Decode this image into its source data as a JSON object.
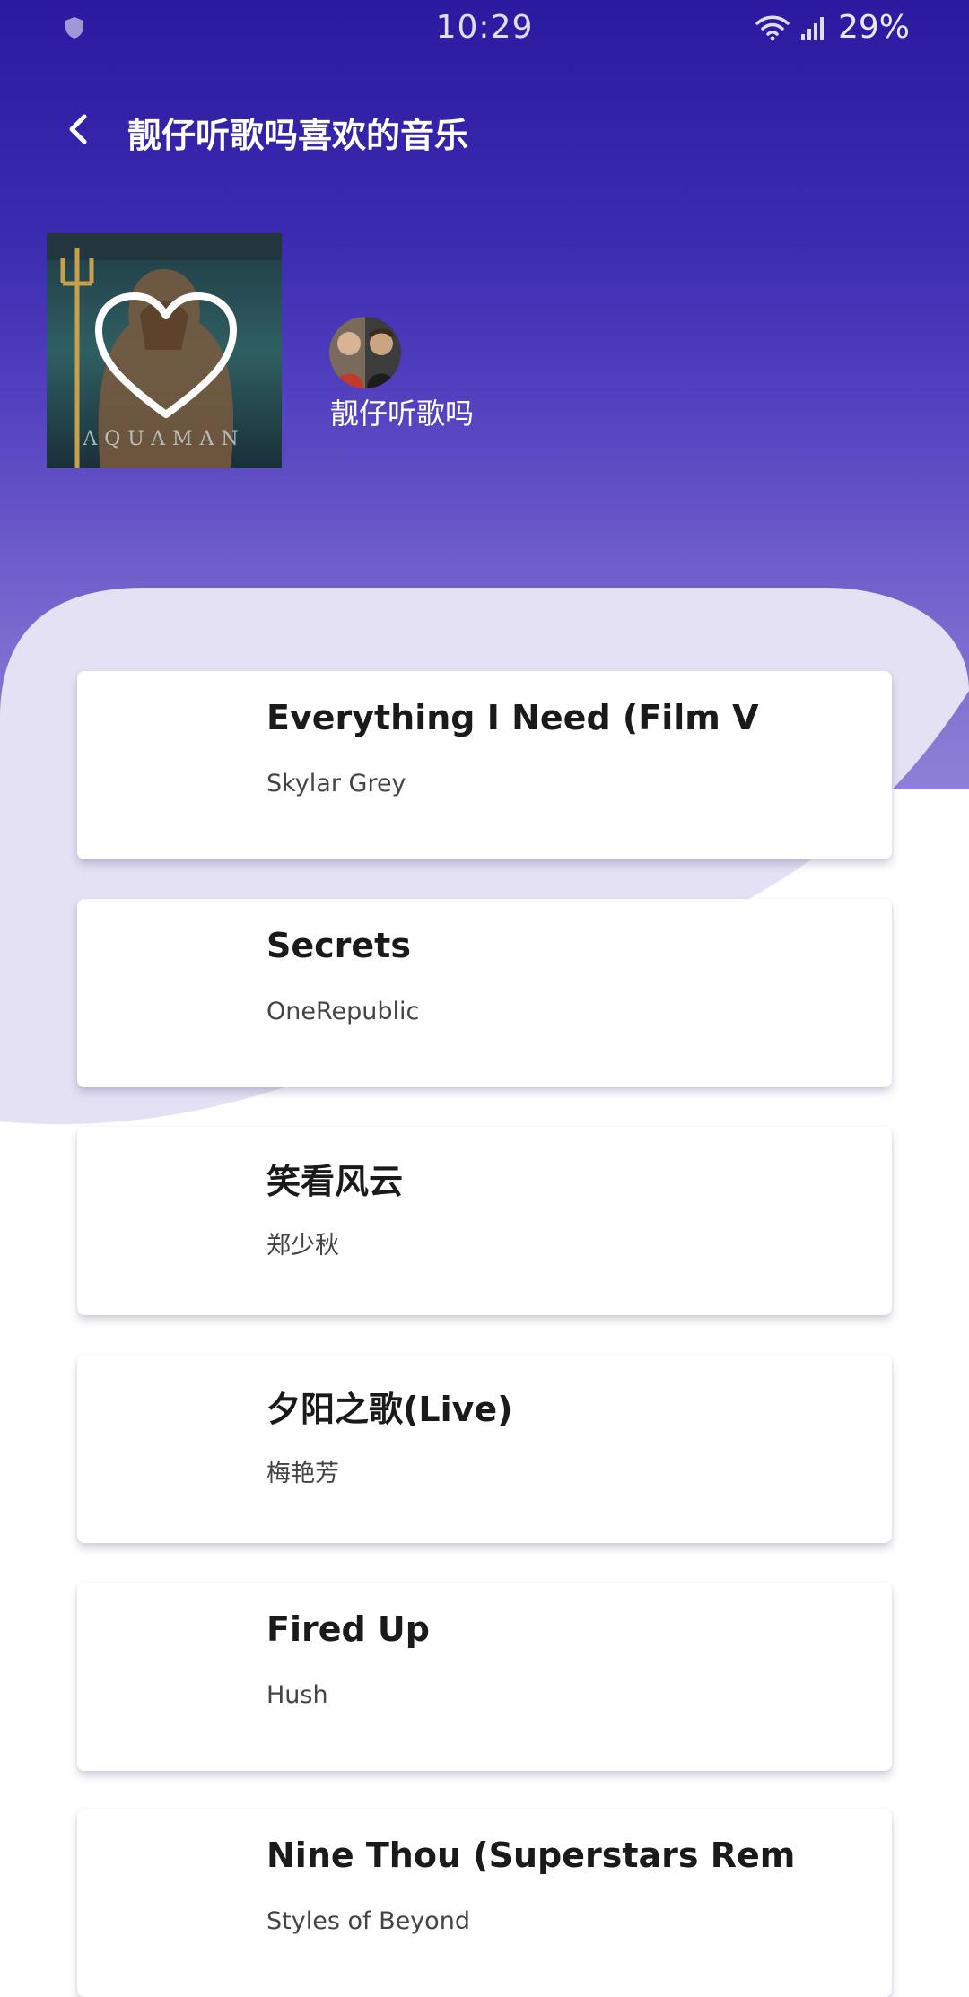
{
  "status_bar": {
    "time": "10:29",
    "battery": "29%",
    "icons": [
      "shield-icon",
      "wifi-icon",
      "signal-icon"
    ]
  },
  "header": {
    "back_icon": "chevron-left-icon",
    "title": "靓仔听歌吗喜欢的音乐"
  },
  "playlist": {
    "cover_icon": "heart-icon",
    "cover_text": "AQUAMAN",
    "owner_name": "靓仔听歌吗"
  },
  "colors": {
    "header_gradient_top": "#2a1aa0",
    "header_gradient_bottom": "#8e80d6",
    "wave": "#e4e1f4",
    "card": "#ffffff"
  },
  "songs": [
    {
      "title": "Everything I Need (Film V",
      "artist": "Skylar Grey"
    },
    {
      "title": "Secrets",
      "artist": "OneRepublic"
    },
    {
      "title": "笑看风云",
      "artist": "郑少秋"
    },
    {
      "title": "夕阳之歌(Live)",
      "artist": "梅艳芳"
    },
    {
      "title": "Fired Up",
      "artist": "Hush"
    },
    {
      "title": "Nine Thou (Superstars Rem",
      "artist": "Styles of Beyond"
    }
  ]
}
